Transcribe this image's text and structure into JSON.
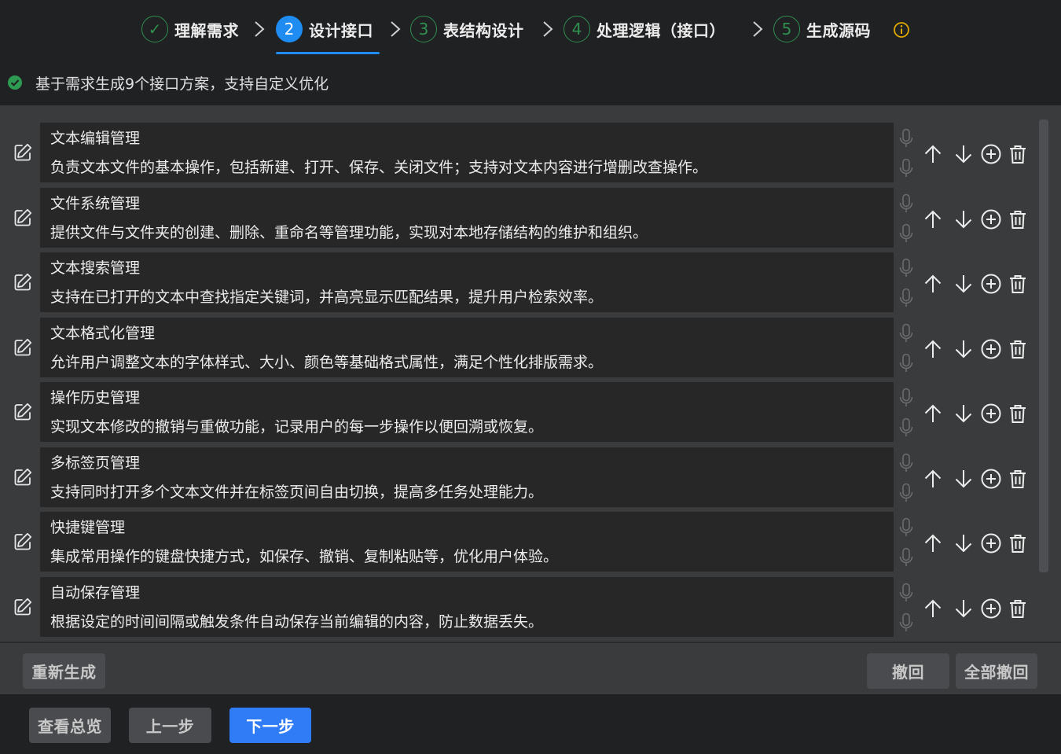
{
  "steps": [
    {
      "num": "✓",
      "label": "理解需求",
      "state": "done"
    },
    {
      "num": "2",
      "label": "设计接口",
      "state": "active"
    },
    {
      "num": "3",
      "label": "表结构设计",
      "state": "todo"
    },
    {
      "num": "4",
      "label": "处理逻辑（接口）",
      "state": "todo"
    },
    {
      "num": "5",
      "label": "生成源码",
      "state": "todo"
    }
  ],
  "status": {
    "text": "基于需求生成9个接口方案，支持自定义优化",
    "icon": "check-circle-icon"
  },
  "items": [
    {
      "title": "文本编辑管理",
      "desc": "负责文本文件的基本操作，包括新建、打开、保存、关闭文件；支持对文本内容进行增删改查操作。"
    },
    {
      "title": "文件系统管理",
      "desc": "提供文件与文件夹的创建、删除、重命名等管理功能，实现对本地存储结构的维护和组织。"
    },
    {
      "title": "文本搜索管理",
      "desc": "支持在已打开的文本中查找指定关键词，并高亮显示匹配结果，提升用户检索效率。"
    },
    {
      "title": "文本格式化管理",
      "desc": "允许用户调整文本的字体样式、大小、颜色等基础格式属性，满足个性化排版需求。"
    },
    {
      "title": "操作历史管理",
      "desc": "实现文本修改的撤销与重做功能，记录用户的每一步操作以便回溯或恢复。"
    },
    {
      "title": "多标签页管理",
      "desc": "支持同时打开多个文本文件并在标签页间自由切换，提高多任务处理能力。"
    },
    {
      "title": "快捷键管理",
      "desc": "集成常用操作的键盘快捷方式，如保存、撤销、复制粘贴等，优化用户体验。"
    },
    {
      "title": "自动保存管理",
      "desc": "根据设定的时间间隔或触发条件自动保存当前编辑的内容，防止数据丢失。"
    }
  ],
  "actions": {
    "regenerate": "重新生成",
    "undo": "撤回",
    "undo_all": "全部撤回"
  },
  "footer": {
    "overview": "查看总览",
    "prev": "上一步",
    "next": "下一步"
  },
  "colors": {
    "accent": "#1e8cf0",
    "success": "#2f8f4f",
    "warning": "#e0a800",
    "primary_button": "#2f7cf6"
  }
}
